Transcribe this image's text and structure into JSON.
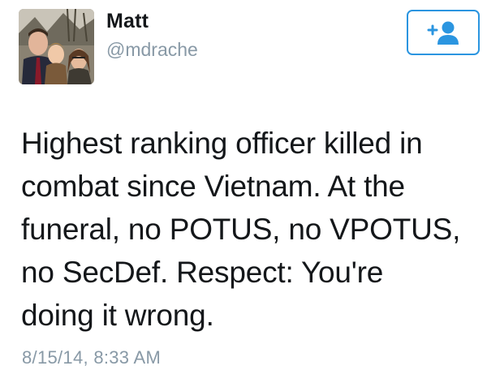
{
  "user": {
    "name": "Matt",
    "handle": "@mdrache",
    "avatar_icon": "profile-photo"
  },
  "follow_button": {
    "icon": "add-user-icon",
    "color": "#2b95e0"
  },
  "tweet": {
    "text": "Highest ranking officer killed in\ncombat since Vietnam. At the\nfuneral, no POTUS, no VPOTUS,\nno SecDef. Respect: You're\ndoing it wrong.",
    "timestamp": "8/15/14, 8:33 AM"
  },
  "colors": {
    "name_text": "#14171a",
    "secondary_text": "#8899a6",
    "accent": "#2b95e0"
  }
}
